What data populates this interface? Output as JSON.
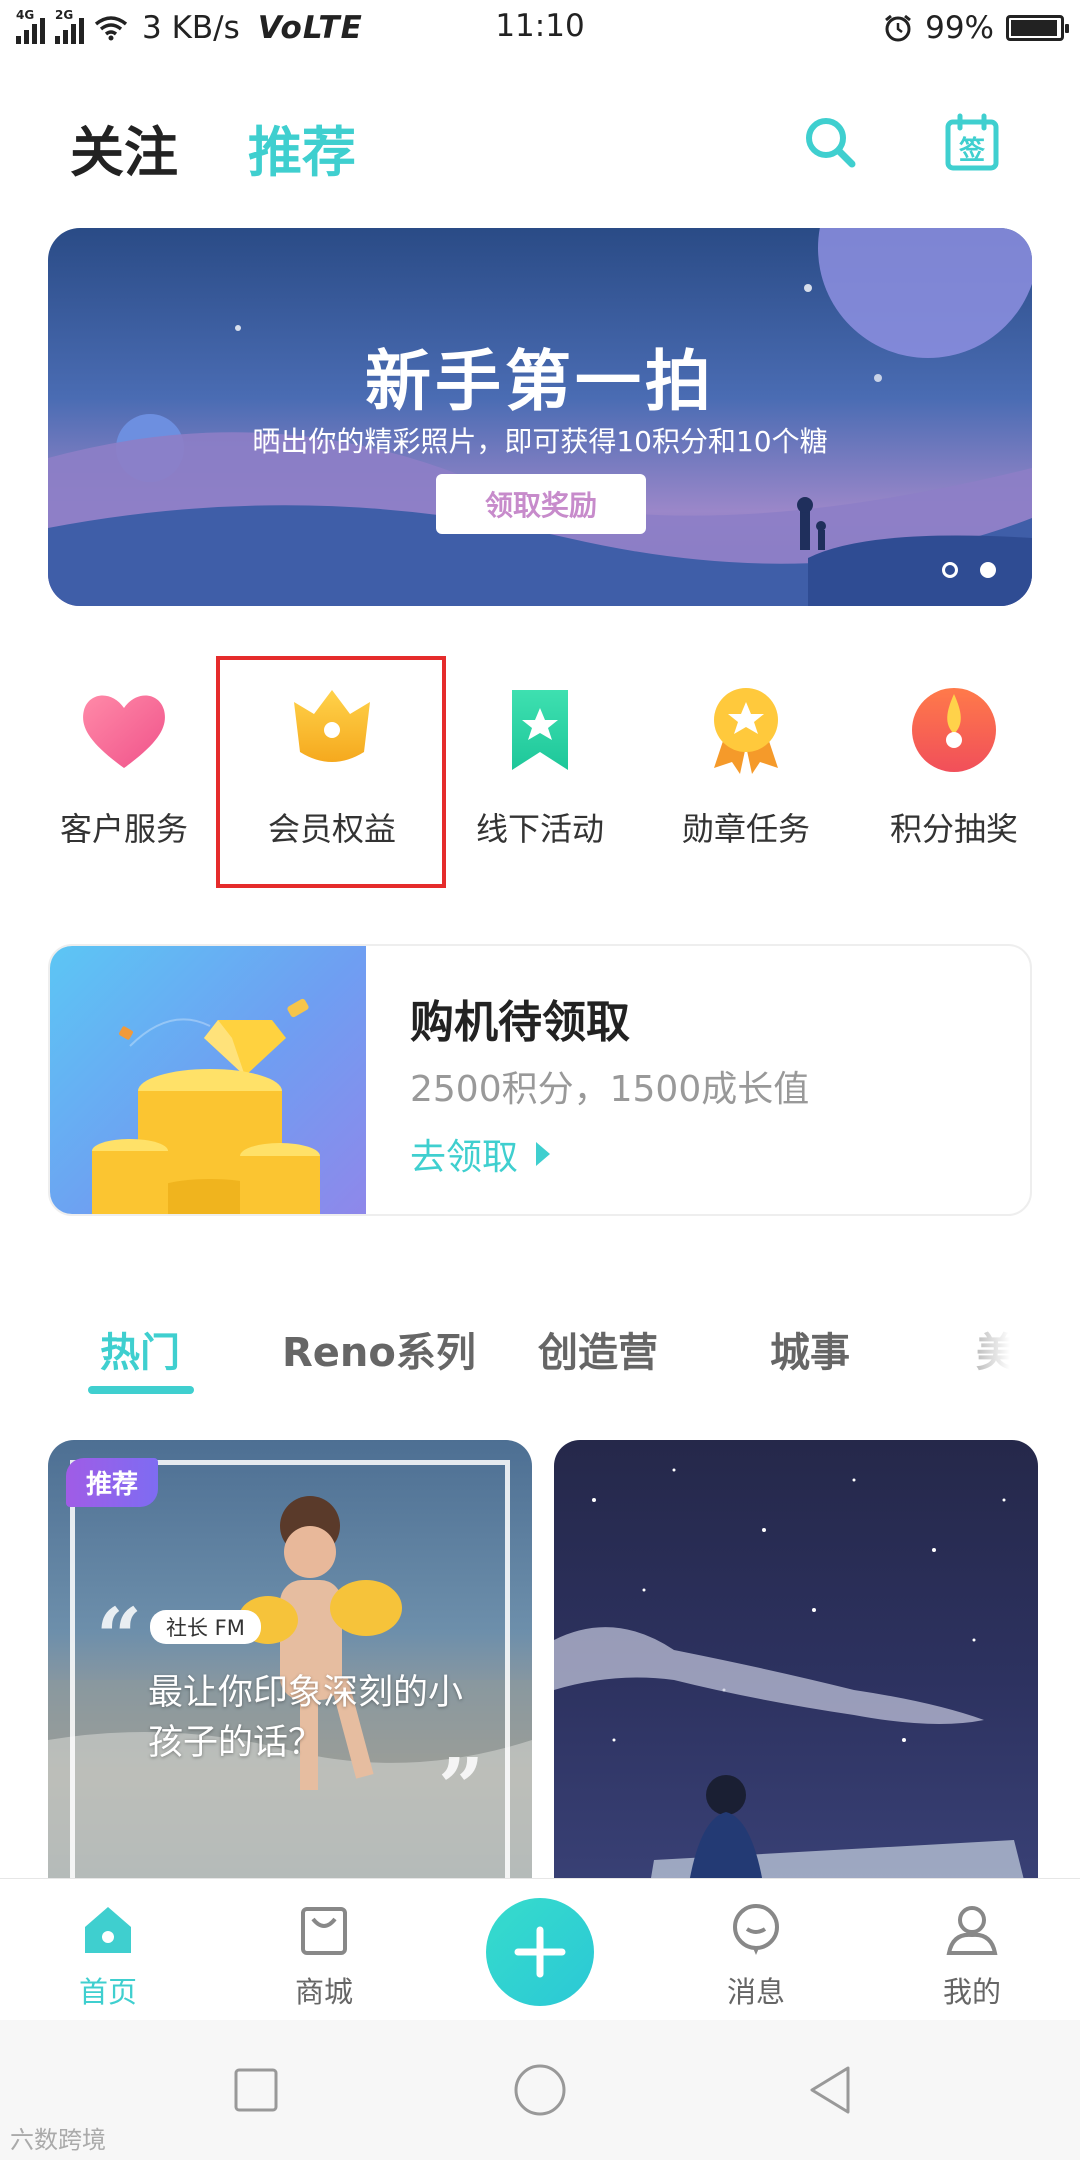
{
  "status_bar": {
    "signal_label": "4G",
    "signal2_label": "2G",
    "speed": "3 KB/s",
    "volte": "VoLTE",
    "time": "11:10",
    "battery": "99%"
  },
  "top_nav": {
    "follow": "关注",
    "recommend": "推荐",
    "calendar_glyph": "签"
  },
  "banner": {
    "title": "新手第一拍",
    "subtitle": "晒出你的精彩照片，即可获得10积分和10个糖",
    "button": "领取奖励",
    "slide_count": 2,
    "active_slide": 2
  },
  "quick_entries": [
    {
      "label": "客户服务",
      "icon": "heart-icon"
    },
    {
      "label": "会员权益",
      "icon": "crown-icon"
    },
    {
      "label": "线下活动",
      "icon": "bookmark-star-icon"
    },
    {
      "label": "勋章任务",
      "icon": "medal-icon"
    },
    {
      "label": "积分抽奖",
      "icon": "lottery-icon"
    }
  ],
  "promo": {
    "title": "购机待领取",
    "subtitle": "2500积分，1500成长值",
    "link": "去领取"
  },
  "categories": [
    {
      "label": "热门",
      "active": true
    },
    {
      "label": "Reno系列",
      "active": false
    },
    {
      "label": "创造营",
      "active": false
    },
    {
      "label": "城事",
      "active": false
    },
    {
      "label": "美",
      "active": false
    }
  ],
  "feed": [
    {
      "badge": "推荐",
      "tag": "社长 FM",
      "text": "最让你印象深刻的小孩子的话？"
    },
    {
      "badge": "",
      "tag": "",
      "text": ""
    }
  ],
  "tab_bar": [
    {
      "label": "首页",
      "icon": "home-icon",
      "active": true
    },
    {
      "label": "商城",
      "icon": "shop-bag-icon",
      "active": false
    },
    {
      "label": "消息",
      "icon": "message-icon",
      "active": false
    },
    {
      "label": "我的",
      "icon": "profile-icon",
      "active": false
    }
  ],
  "colors": {
    "accent": "#3fcfcf",
    "highlight_box": "#e52b2b",
    "text_primary": "#222222",
    "text_secondary": "#999999"
  },
  "watermark": "六数跨境"
}
